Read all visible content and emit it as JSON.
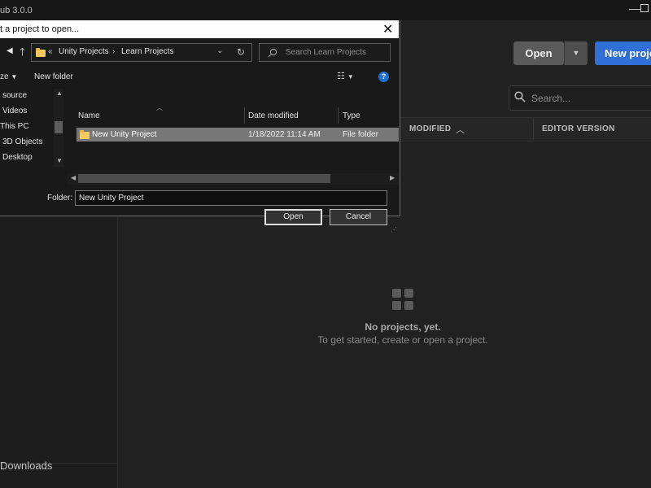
{
  "hub": {
    "title": "ub 3.0.0",
    "open_label": "Open",
    "open_dropdown_icon": "chevron-down-icon",
    "new_project_label": "New project",
    "search_placeholder": "Search...",
    "columns": {
      "modified": "MODIFIED",
      "editor_version": "EDITOR VERSION"
    },
    "empty_title": "No projects, yet.",
    "empty_subtitle": "To get started, create or open a project.",
    "sidebar_downloads": "Downloads",
    "accent_color": "#2f6fd6"
  },
  "dialog": {
    "title": "t a project to open...",
    "breadcrumb_prefix": "«",
    "breadcrumbs": [
      "Unity Projects",
      "Learn Projects"
    ],
    "search_placeholder": "Search Learn Projects",
    "organize_label": "ze",
    "new_folder_label": "New folder",
    "nav_items": [
      "source",
      "Videos",
      "This PC",
      "3D Objects",
      "Desktop"
    ],
    "columns": {
      "name": "Name",
      "date_modified": "Date modified",
      "type": "Type"
    },
    "rows": [
      {
        "name": "New Unity Project",
        "date": "1/18/2022 11:14 AM",
        "type": "File folder"
      }
    ],
    "folder_label": "Folder:",
    "folder_value": "New Unity Project",
    "open_label": "Open",
    "cancel_label": "Cancel"
  }
}
